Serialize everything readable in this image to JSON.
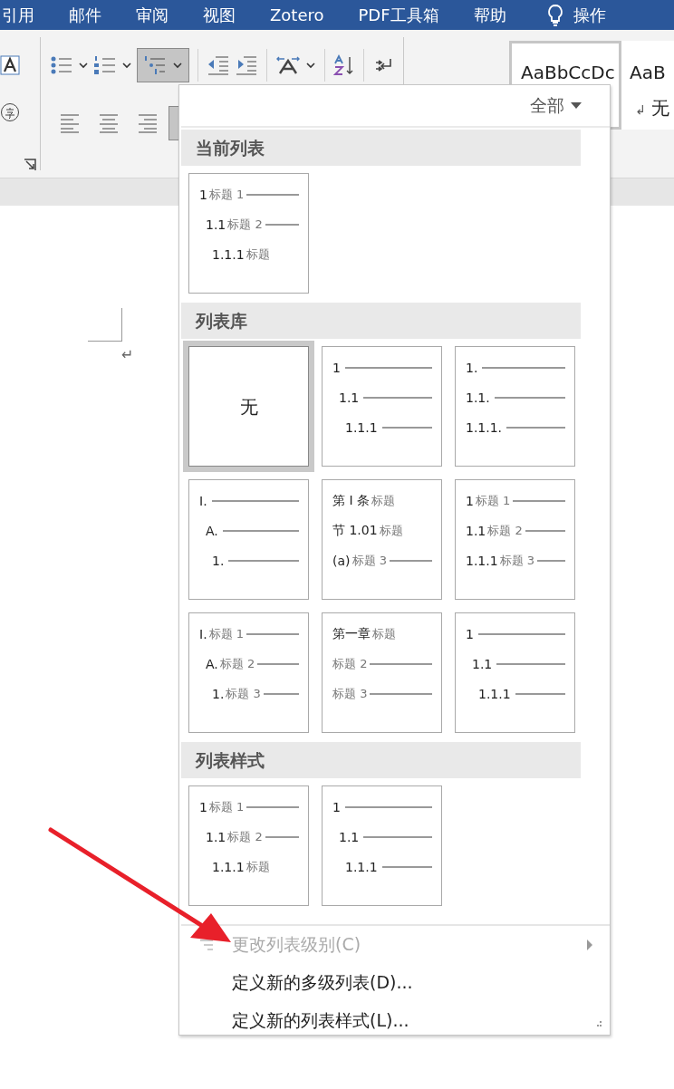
{
  "menu_tabs": [
    "引用",
    "邮件",
    "审阅",
    "视图",
    "Zotero",
    "PDF工具箱",
    "帮助"
  ],
  "tell_me": "操作",
  "ribbon": {
    "multilevel_pressed": true,
    "justify_pressed": true,
    "styles": [
      {
        "sample": "AaBbCcDc",
        "selected": true
      },
      {
        "sample": "AaB",
        "caption": "无",
        "selected": false
      }
    ],
    "paragraph_mark": "↲"
  },
  "document": {
    "paragraph_mark": "↵"
  },
  "dropdown": {
    "filter": "全部",
    "sections": [
      {
        "title": "当前列表",
        "items": [
          {
            "indent": true,
            "selected": false,
            "lines": [
              {
                "num": "1",
                "label": "标题 1",
                "rule": true
              },
              {
                "num": "1.1",
                "label": "标题 2",
                "rule": true
              },
              {
                "num": "1.1.1",
                "label": "标题",
                "rule": false
              }
            ]
          }
        ]
      },
      {
        "title": "列表库",
        "items": [
          {
            "none": "无",
            "selected": true
          },
          {
            "indent": true,
            "selected": false,
            "lines": [
              {
                "num": "1",
                "rule": true
              },
              {
                "num": "1.1",
                "rule": true
              },
              {
                "num": "1.1.1",
                "rule": true
              }
            ]
          },
          {
            "indent": false,
            "selected": false,
            "lines": [
              {
                "num": "1.",
                "rule": true
              },
              {
                "num": "1.1.",
                "rule": true
              },
              {
                "num": "1.1.1.",
                "rule": true
              }
            ]
          },
          {
            "indent": true,
            "selected": false,
            "lines": [
              {
                "num": "I.",
                "rule": true
              },
              {
                "num": "A.",
                "rule": true
              },
              {
                "num": "1.",
                "rule": true
              }
            ]
          },
          {
            "indent": false,
            "selected": false,
            "lines": [
              {
                "num": "第 I 条",
                "label": "标题",
                "rule": false
              },
              {
                "num": "节 1.01",
                "label": "标题",
                "rule": false
              },
              {
                "num": "(a)",
                "label": "标题 3",
                "rule": true
              }
            ]
          },
          {
            "indent": false,
            "selected": false,
            "lines": [
              {
                "num": "1",
                "label": "标题 1",
                "rule": true
              },
              {
                "num": "1.1",
                "label": "标题 2",
                "rule": true
              },
              {
                "num": "1.1.1",
                "label": "标题 3",
                "rule": true
              }
            ]
          },
          {
            "indent": true,
            "selected": false,
            "lines": [
              {
                "num": "I.",
                "label": "标题 1",
                "rule": true
              },
              {
                "num": "A.",
                "label": "标题 2",
                "rule": true
              },
              {
                "num": "1.",
                "label": "标题 3",
                "rule": true
              }
            ]
          },
          {
            "indent": false,
            "selected": false,
            "lines": [
              {
                "num": "第一章",
                "label": "标题",
                "rule": false
              },
              {
                "label": "标题 2",
                "rule": true
              },
              {
                "label": "标题 3",
                "rule": true
              }
            ]
          },
          {
            "indent": true,
            "selected": false,
            "lines": [
              {
                "num": "1",
                "rule": true
              },
              {
                "num": "1.1",
                "rule": true
              },
              {
                "num": "1.1.1",
                "rule": true
              }
            ]
          }
        ]
      },
      {
        "title": "列表样式",
        "items": [
          {
            "indent": true,
            "selected": false,
            "lines": [
              {
                "num": "1",
                "label": "标题 1",
                "rule": true
              },
              {
                "num": "1.1",
                "label": "标题 2",
                "rule": true
              },
              {
                "num": "1.1.1",
                "label": "标题",
                "rule": false
              }
            ]
          },
          {
            "indent": true,
            "selected": false,
            "lines": [
              {
                "num": "1",
                "rule": true
              },
              {
                "num": "1.1",
                "rule": true
              },
              {
                "num": "1.1.1",
                "rule": true
              }
            ]
          }
        ]
      }
    ],
    "commands": [
      {
        "label": "更改列表级别(C)",
        "disabled": true,
        "submenu": true,
        "icon": true
      },
      {
        "label": "定义新的多级列表(D)...",
        "disabled": false,
        "submenu": false,
        "icon": false
      },
      {
        "label": "定义新的列表样式(L)...",
        "disabled": false,
        "submenu": false,
        "icon": false
      }
    ]
  }
}
